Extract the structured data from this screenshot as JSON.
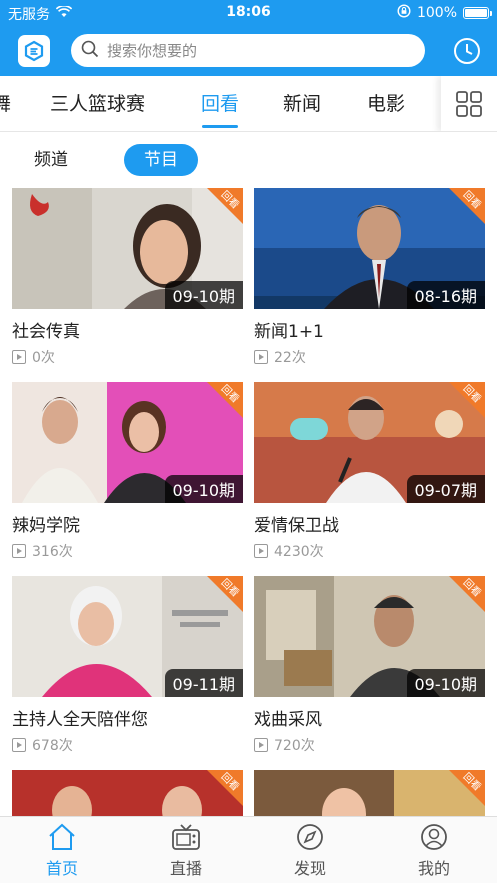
{
  "status_bar": {
    "carrier": "无服务",
    "time": "18:06",
    "battery": "100%"
  },
  "header": {
    "logo_icon": "app-logo",
    "search_placeholder": "搜索你想要的",
    "history_icon": "clock-icon"
  },
  "channel_tabs": {
    "items": [
      {
        "label": "舞"
      },
      {
        "label": "三人篮球赛"
      },
      {
        "label": "回看"
      },
      {
        "label": "新闻"
      },
      {
        "label": "电影"
      }
    ],
    "active": "回看",
    "grid_icon": "grid-icon"
  },
  "sub_tabs": {
    "items": [
      {
        "label": "频道"
      },
      {
        "label": "节目"
      }
    ],
    "active": "节目"
  },
  "ribbon_label": "回看",
  "programs": [
    {
      "title": "社会传真",
      "period": "09-10期",
      "views": "0次"
    },
    {
      "title": "新闻1+1",
      "period": "08-16期",
      "views": "22次"
    },
    {
      "title": "辣妈学院",
      "period": "09-10期",
      "views": "316次"
    },
    {
      "title": "爱情保卫战",
      "period": "09-07期",
      "views": "4230次"
    },
    {
      "title": "主持人全天陪伴您",
      "period": "09-11期",
      "views": "678次"
    },
    {
      "title": "戏曲采风",
      "period": "09-10期",
      "views": "720次"
    },
    {
      "title": "",
      "period": "",
      "views": ""
    },
    {
      "title": "",
      "period": "",
      "views": ""
    }
  ],
  "bottom_nav": [
    {
      "label": "首页",
      "icon": "home-icon"
    },
    {
      "label": "直播",
      "icon": "tv-icon"
    },
    {
      "label": "发现",
      "icon": "compass-icon"
    },
    {
      "label": "我的",
      "icon": "profile-icon"
    }
  ],
  "colors": {
    "accent": "#1e9bf0",
    "ribbon": "#f07a2a"
  }
}
